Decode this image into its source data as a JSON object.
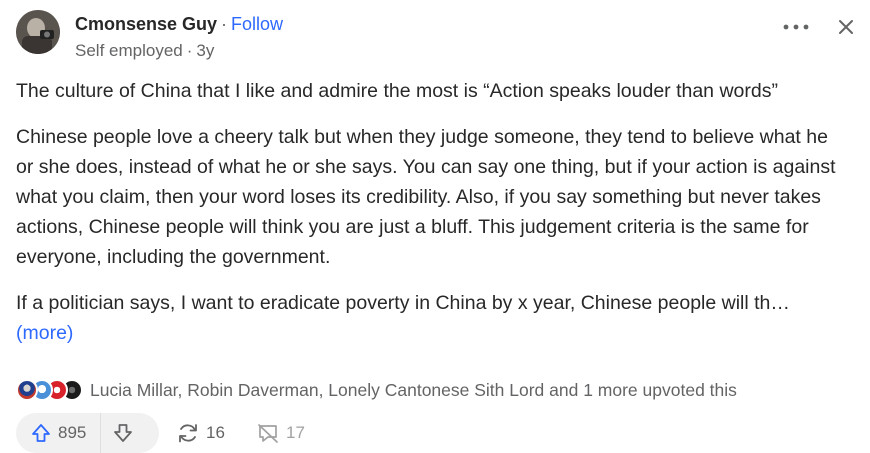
{
  "author": {
    "name": "Cmonsense Guy",
    "separator": "·",
    "follow_label": "Follow",
    "credential": "Self employed",
    "time": "3y"
  },
  "post": {
    "paragraphs": [
      "The culture of China that I like and admire the most is “Action speaks louder than words”",
      "Chinese people love a cheery talk but when they judge someone, they tend to believe what he or she does, instead of what he or she says. You can say one thing, but if your action is against what you claim, then your word loses its credibility. Also, if you say something but never takes actions, Chinese people will think you are just a bluff. This judgement criteria is the same for everyone, including the government."
    ],
    "truncated_text": "If a politician says, I want to eradicate poverty in China by x year, Chinese people will th…",
    "more_label": "(more)"
  },
  "upvoters": {
    "text": "Lucia Millar, Robin Daverman, Lonely Cantonese Sith Lord and 1 more upvoted this"
  },
  "actions": {
    "upvotes": "895",
    "shares": "16",
    "comments": "17"
  },
  "icons": {
    "more": "more-horizontal-icon",
    "close": "close-icon",
    "upvote": "upvote-arrow-icon",
    "downvote": "downvote-arrow-icon",
    "share": "share-icon",
    "comment": "comment-icon"
  },
  "colors": {
    "accent": "#2e69ff",
    "text": "#282829",
    "muted": "#636466",
    "pill": "#f1f1f2"
  }
}
